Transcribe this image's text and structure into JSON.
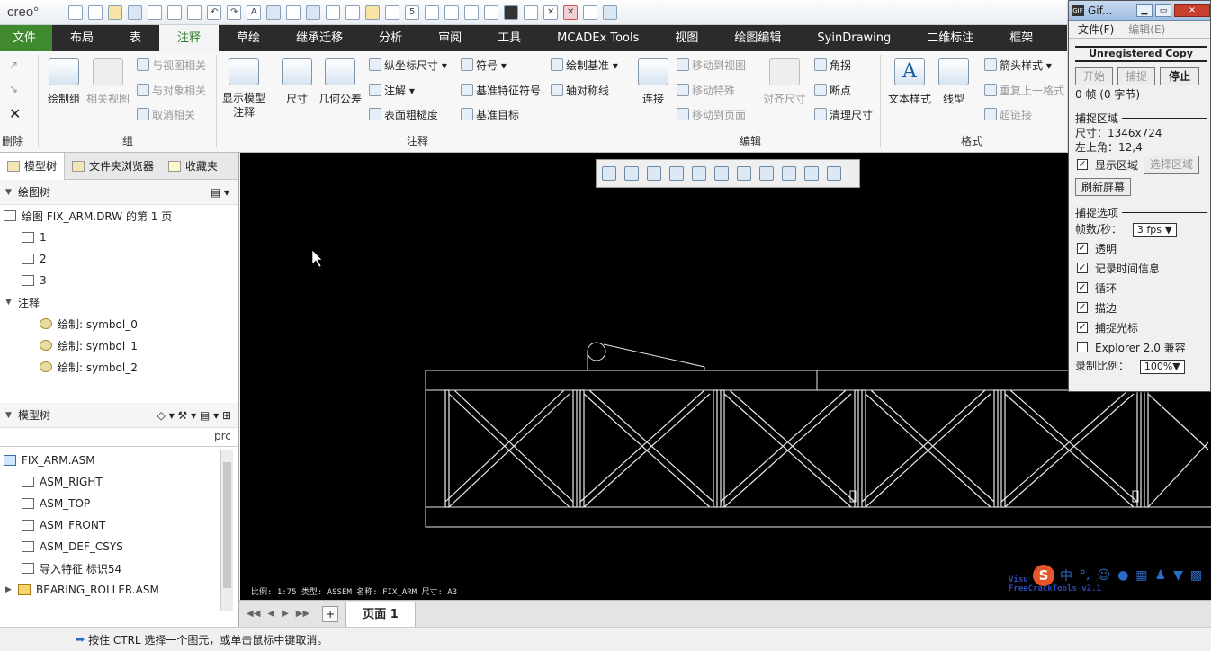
{
  "app": {
    "logo": "creo°"
  },
  "quickbar": {
    "icons": [
      "new-icon",
      "open-icon",
      "open-folder-icon",
      "save-icon",
      "print-icon",
      "regenerate-icon",
      "window-icon",
      "undo-icon",
      "redo-icon",
      "annotation-icon",
      "datum-icon",
      "select-box-icon",
      "model-icon",
      "layers-icon",
      "tool-icon",
      "target-icon",
      "repeat-icon",
      "number-icon",
      "pen-icon",
      "user-icon",
      "settings-icon",
      "print2-icon",
      "table-icon",
      "no-icon",
      "close-red-icon",
      "window2-icon",
      "cube-icon"
    ]
  },
  "tabs": [
    "文件",
    "布局",
    "表",
    "注释",
    "草绘",
    "继承迁移",
    "分析",
    "审阅",
    "工具",
    "MCADEx Tools",
    "视图",
    "绘图编辑",
    "SyinDrawing",
    "二维标注",
    "框架"
  ],
  "ribbon": {
    "delete_group": {
      "label": "删除"
    },
    "group_group": {
      "label": "组",
      "big1": "绘制组",
      "big2": "相关视图",
      "items": [
        "与视图相关",
        "与对象相关",
        "取消相关"
      ]
    },
    "annotation_group": {
      "label": "注释",
      "show_model": "显示模型注释",
      "dim": "尺寸",
      "gtol": "几何公差",
      "items": [
        "纵坐标尺寸",
        "注解",
        "表面粗糙度",
        "符号",
        "基准特征符号",
        "基准目标",
        "绘制基准",
        "轴对称线"
      ]
    },
    "edit_group": {
      "label": "编辑",
      "connect": "连接",
      "items": [
        "移动到视图",
        "移动特殊",
        "移动到页面",
        "对齐尺寸",
        "角拐",
        "断点",
        "清理尺寸"
      ]
    },
    "format_group": {
      "label": "格式",
      "text_style": "文本样式",
      "line_style": "线型",
      "items": [
        "箭头样式",
        "重复上一格式",
        "超链接"
      ]
    }
  },
  "nav_tabs": [
    "模型树",
    "文件夹浏览器",
    "收藏夹"
  ],
  "drawing_tree": {
    "title": "绘图树",
    "root": "绘图 FIX_ARM.DRW 的第 1 页",
    "views": [
      "1",
      "2",
      "3"
    ],
    "annot_header": "注释",
    "symbols": [
      "绘制: symbol_0",
      "绘制: symbol_1",
      "绘制: symbol_2"
    ]
  },
  "model_tree": {
    "title": "模型树",
    "column": "prc",
    "items": [
      "FIX_ARM.ASM",
      "ASM_RIGHT",
      "ASM_TOP",
      "ASM_FRONT",
      "ASM_DEF_CSYS",
      "导入特征 标识54",
      "BEARING_ROLLER.ASM"
    ]
  },
  "canvas": {
    "status_text": "比例: 1:75     类型: ASSEM     名称: FIX_ARM    尺寸: A3"
  },
  "page_bar": {
    "tab": "页面 1"
  },
  "status_bar": {
    "message": "按住 CTRL 选择一个图元，或单击鼠标中键取消。"
  },
  "gif_window": {
    "title": "Gif...",
    "menu": [
      "文件(F)",
      "编辑(E)"
    ],
    "unregistered": "Unregistered Copy",
    "buttons": [
      "开始",
      "捕捉",
      "停止"
    ],
    "frames": "0 帧 (0 字节)",
    "capture_area_header": "捕捉区域",
    "size_label": "尺寸：1346x724",
    "topleft_label": "左上角：12,4",
    "show_area": "显示区域",
    "select_area": "选择区域",
    "refresh": "刷新屏幕",
    "options_header": "捕捉选项",
    "fps_label": "帧数/秒：",
    "fps_value": "3 fps ▼",
    "options": [
      "透明",
      "记录时间信息",
      "循环",
      "描边",
      "捕捉光标"
    ],
    "explorer_compat": "Explorer 2.0 兼容",
    "scale_label": "录制比例：",
    "scale_value": "100%▼"
  },
  "ime": {
    "logo": "S",
    "lang": "中"
  },
  "watermark": {
    "line1": "Visu",
    "line2": "FreeCrackTools v2.1"
  }
}
